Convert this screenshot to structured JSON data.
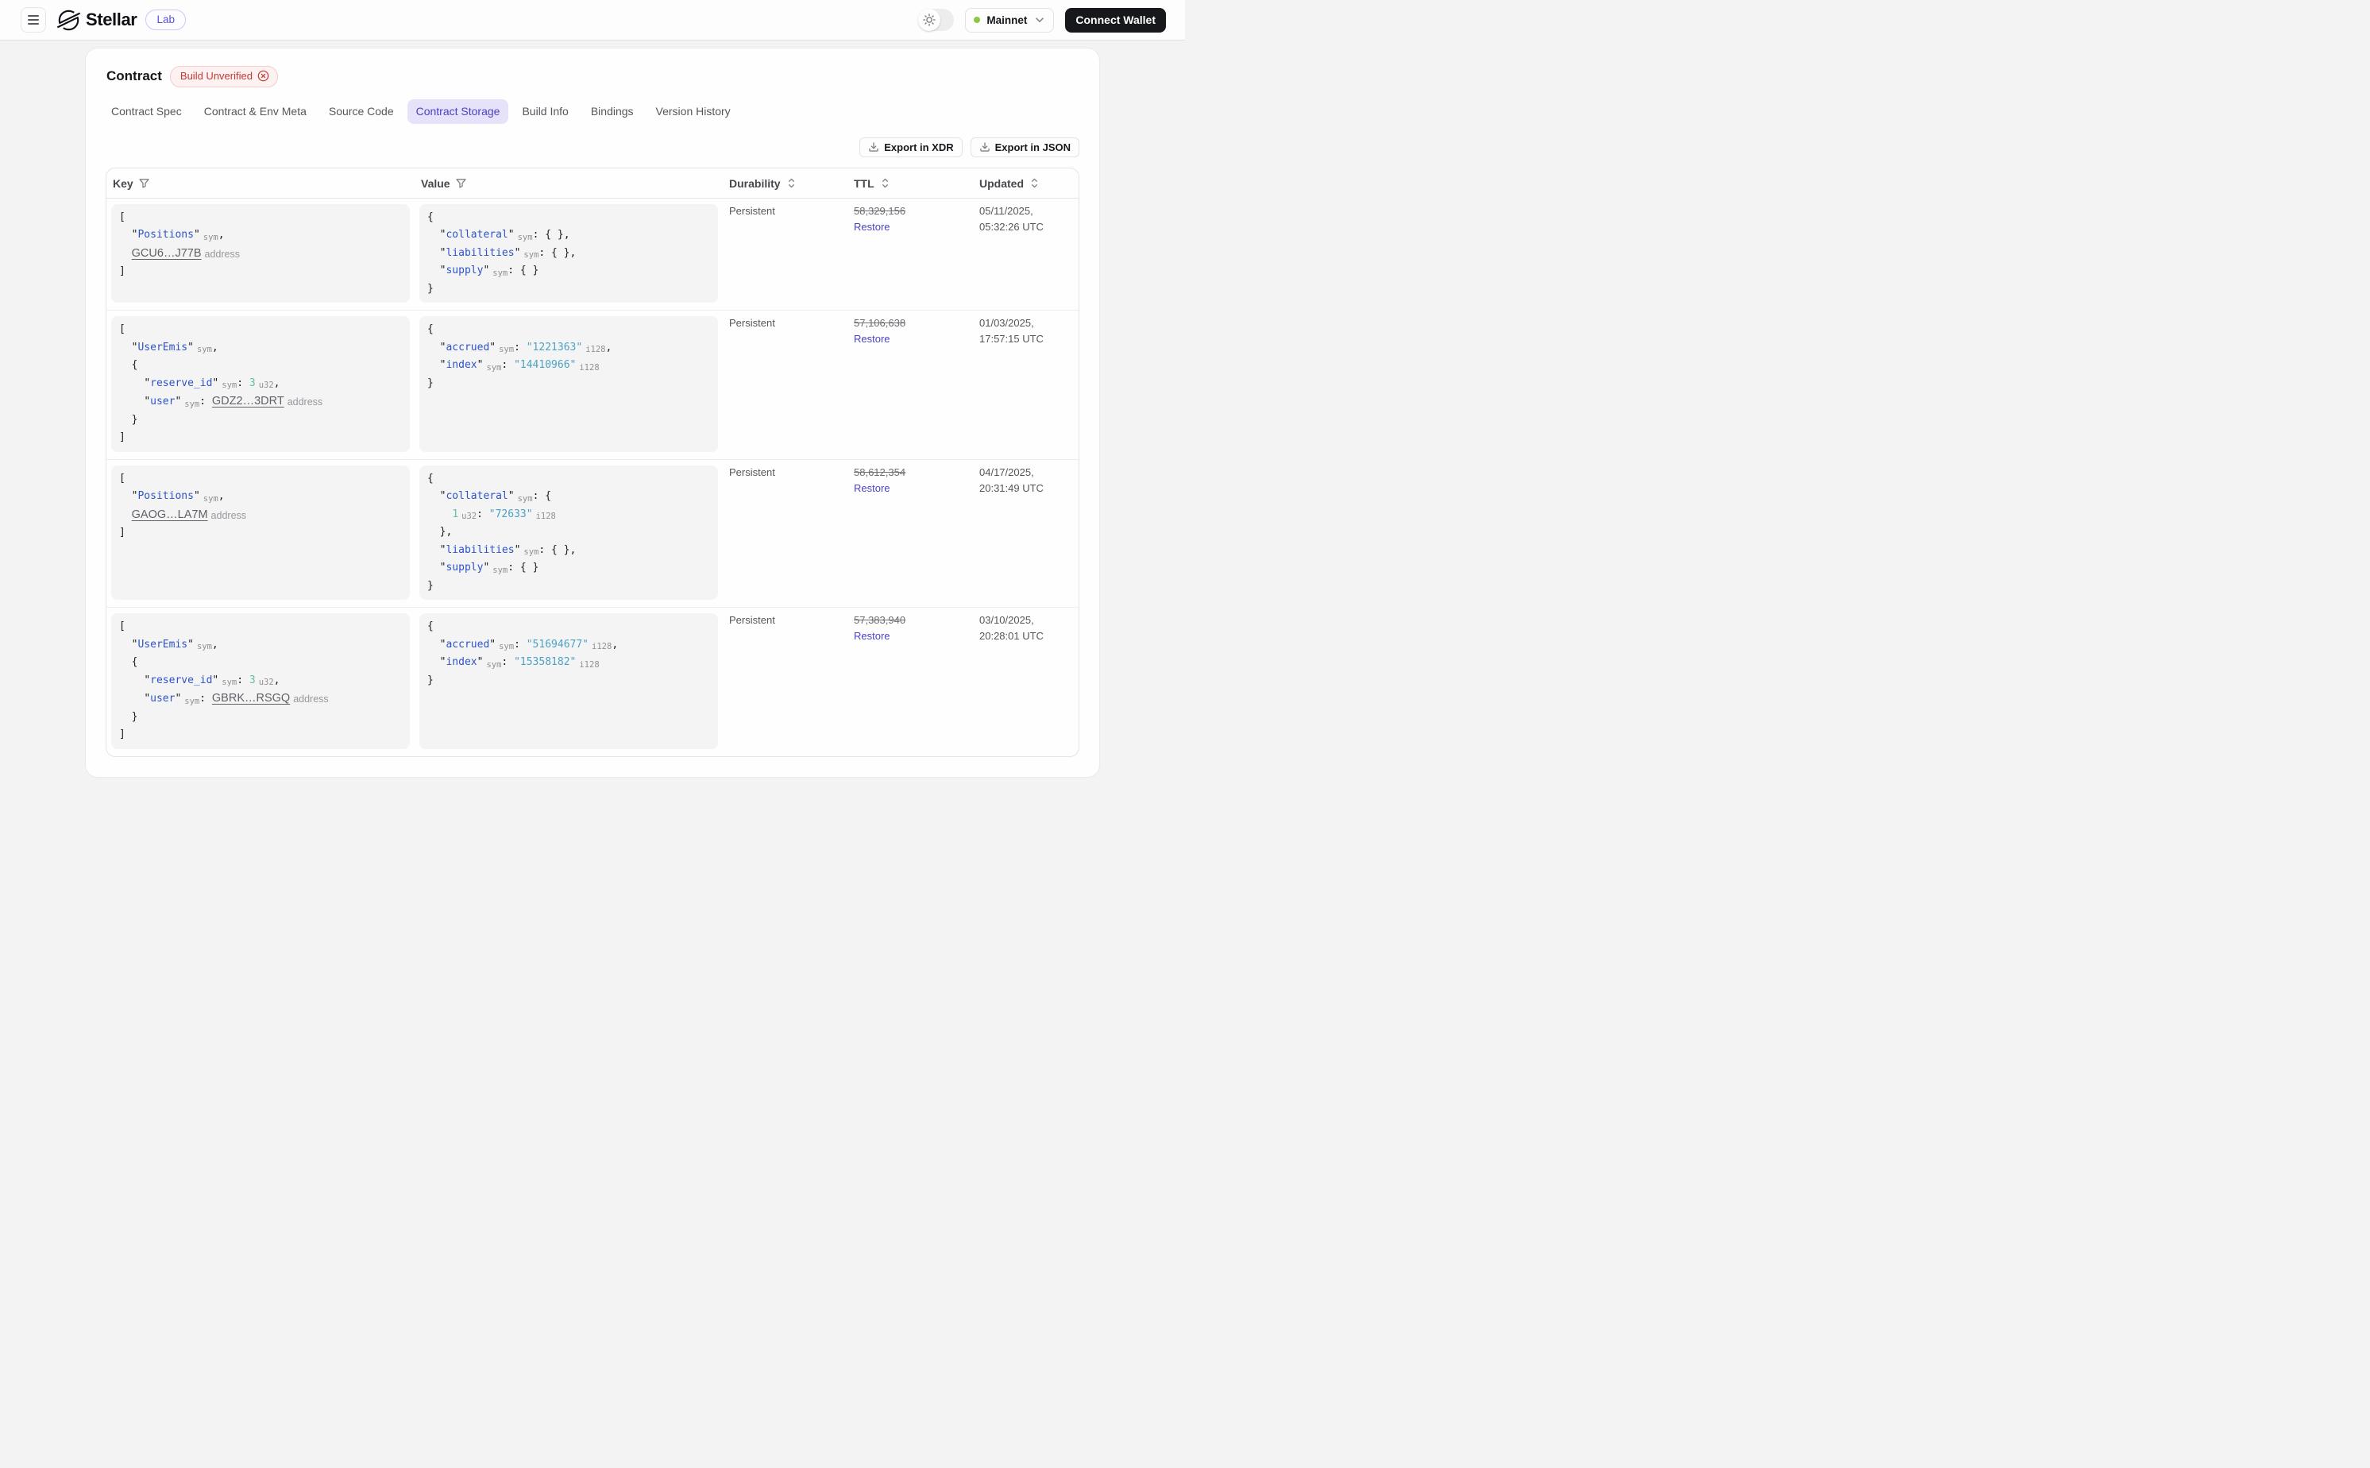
{
  "navbar": {
    "brand": "Stellar",
    "brand_badge": "Lab",
    "network_label": "Mainnet",
    "connect_wallet_label": "Connect Wallet"
  },
  "page": {
    "title": "Contract",
    "status_badge": "Build Unverified",
    "tabs": [
      {
        "label": "Contract Spec",
        "active": false
      },
      {
        "label": "Contract & Env Meta",
        "active": false
      },
      {
        "label": "Source Code",
        "active": false
      },
      {
        "label": "Contract Storage",
        "active": true
      },
      {
        "label": "Build Info",
        "active": false
      },
      {
        "label": "Bindings",
        "active": false
      },
      {
        "label": "Version History",
        "active": false
      }
    ],
    "export_xdr_label": "Export in XDR",
    "export_json_label": "Export in JSON"
  },
  "table": {
    "columns": [
      {
        "label": "Key",
        "icon": "filter"
      },
      {
        "label": "Value",
        "icon": "filter"
      },
      {
        "label": "Durability",
        "icon": "sort"
      },
      {
        "label": "TTL",
        "icon": "sort"
      },
      {
        "label": "Updated",
        "icon": "sort"
      }
    ],
    "rows": [
      {
        "key_code": [
          [
            {
              "t": "p",
              "v": "["
            }
          ],
          [
            {
              "t": "p",
              "v": "  "
            },
            {
              "t": "key",
              "v": "Positions"
            },
            {
              "t": "ann",
              "v": "sym"
            },
            {
              "t": "p",
              "v": ","
            }
          ],
          [
            {
              "t": "p",
              "v": "  "
            },
            {
              "t": "link",
              "v": "GCU6…J77B"
            },
            {
              "t": "ann",
              "v": "address"
            }
          ],
          [
            {
              "t": "p",
              "v": "]"
            }
          ]
        ],
        "value_code": [
          [
            {
              "t": "p",
              "v": "{"
            }
          ],
          [
            {
              "t": "p",
              "v": "  "
            },
            {
              "t": "key",
              "v": "collateral"
            },
            {
              "t": "ann",
              "v": "sym"
            },
            {
              "t": "p",
              "v": ": { },"
            }
          ],
          [
            {
              "t": "p",
              "v": "  "
            },
            {
              "t": "key",
              "v": "liabilities"
            },
            {
              "t": "ann",
              "v": "sym"
            },
            {
              "t": "p",
              "v": ": { },"
            }
          ],
          [
            {
              "t": "p",
              "v": "  "
            },
            {
              "t": "key",
              "v": "supply"
            },
            {
              "t": "ann",
              "v": "sym"
            },
            {
              "t": "p",
              "v": ": { }"
            }
          ],
          [
            {
              "t": "p",
              "v": "}"
            }
          ]
        ],
        "durability": "Persistent",
        "ttl": "58,329,156",
        "ttl_action": "Restore",
        "updated": [
          "05/11/2025,",
          "05:32:26 UTC"
        ]
      },
      {
        "key_code": [
          [
            {
              "t": "p",
              "v": "["
            }
          ],
          [
            {
              "t": "p",
              "v": "  "
            },
            {
              "t": "key",
              "v": "UserEmis"
            },
            {
              "t": "ann",
              "v": "sym"
            },
            {
              "t": "p",
              "v": ","
            }
          ],
          [
            {
              "t": "p",
              "v": "  {"
            }
          ],
          [
            {
              "t": "p",
              "v": "    "
            },
            {
              "t": "key",
              "v": "reserve_id"
            },
            {
              "t": "ann",
              "v": "sym"
            },
            {
              "t": "p",
              "v": ": "
            },
            {
              "t": "num",
              "v": "3"
            },
            {
              "t": "ann",
              "v": "u32"
            },
            {
              "t": "p",
              "v": ","
            }
          ],
          [
            {
              "t": "p",
              "v": "    "
            },
            {
              "t": "key",
              "v": "user"
            },
            {
              "t": "ann",
              "v": "sym"
            },
            {
              "t": "p",
              "v": ": "
            },
            {
              "t": "link",
              "v": "GDZ2…3DRT"
            },
            {
              "t": "ann",
              "v": "address"
            }
          ],
          [
            {
              "t": "p",
              "v": "  }"
            }
          ],
          [
            {
              "t": "p",
              "v": "]"
            }
          ]
        ],
        "value_code": [
          [
            {
              "t": "p",
              "v": "{"
            }
          ],
          [
            {
              "t": "p",
              "v": "  "
            },
            {
              "t": "key",
              "v": "accrued"
            },
            {
              "t": "ann",
              "v": "sym"
            },
            {
              "t": "p",
              "v": ": "
            },
            {
              "t": "str",
              "v": "1221363"
            },
            {
              "t": "ann",
              "v": "i128"
            },
            {
              "t": "p",
              "v": ","
            }
          ],
          [
            {
              "t": "p",
              "v": "  "
            },
            {
              "t": "key",
              "v": "index"
            },
            {
              "t": "ann",
              "v": "sym"
            },
            {
              "t": "p",
              "v": ": "
            },
            {
              "t": "str",
              "v": "14410966"
            },
            {
              "t": "ann",
              "v": "i128"
            }
          ],
          [
            {
              "t": "p",
              "v": "}"
            }
          ]
        ],
        "durability": "Persistent",
        "ttl": "57,106,638",
        "ttl_action": "Restore",
        "updated": [
          "01/03/2025,",
          "17:57:15 UTC"
        ]
      },
      {
        "key_code": [
          [
            {
              "t": "p",
              "v": "["
            }
          ],
          [
            {
              "t": "p",
              "v": "  "
            },
            {
              "t": "key",
              "v": "Positions"
            },
            {
              "t": "ann",
              "v": "sym"
            },
            {
              "t": "p",
              "v": ","
            }
          ],
          [
            {
              "t": "p",
              "v": "  "
            },
            {
              "t": "link",
              "v": "GAOG…LA7M"
            },
            {
              "t": "ann",
              "v": "address"
            }
          ],
          [
            {
              "t": "p",
              "v": "]"
            }
          ]
        ],
        "value_code": [
          [
            {
              "t": "p",
              "v": "{"
            }
          ],
          [
            {
              "t": "p",
              "v": "  "
            },
            {
              "t": "key",
              "v": "collateral"
            },
            {
              "t": "ann",
              "v": "sym"
            },
            {
              "t": "p",
              "v": ": {"
            }
          ],
          [
            {
              "t": "p",
              "v": "    "
            },
            {
              "t": "num",
              "v": "1"
            },
            {
              "t": "ann",
              "v": "u32"
            },
            {
              "t": "p",
              "v": ": "
            },
            {
              "t": "str",
              "v": "72633"
            },
            {
              "t": "ann",
              "v": "i128"
            }
          ],
          [
            {
              "t": "p",
              "v": "  },"
            }
          ],
          [
            {
              "t": "p",
              "v": "  "
            },
            {
              "t": "key",
              "v": "liabilities"
            },
            {
              "t": "ann",
              "v": "sym"
            },
            {
              "t": "p",
              "v": ": { },"
            }
          ],
          [
            {
              "t": "p",
              "v": "  "
            },
            {
              "t": "key",
              "v": "supply"
            },
            {
              "t": "ann",
              "v": "sym"
            },
            {
              "t": "p",
              "v": ": { }"
            }
          ],
          [
            {
              "t": "p",
              "v": "}"
            }
          ]
        ],
        "durability": "Persistent",
        "ttl": "58,612,354",
        "ttl_action": "Restore",
        "updated": [
          "04/17/2025,",
          "20:31:49 UTC"
        ]
      },
      {
        "key_code": [
          [
            {
              "t": "p",
              "v": "["
            }
          ],
          [
            {
              "t": "p",
              "v": "  "
            },
            {
              "t": "key",
              "v": "UserEmis"
            },
            {
              "t": "ann",
              "v": "sym"
            },
            {
              "t": "p",
              "v": ","
            }
          ],
          [
            {
              "t": "p",
              "v": "  {"
            }
          ],
          [
            {
              "t": "p",
              "v": "    "
            },
            {
              "t": "key",
              "v": "reserve_id"
            },
            {
              "t": "ann",
              "v": "sym"
            },
            {
              "t": "p",
              "v": ": "
            },
            {
              "t": "num",
              "v": "3"
            },
            {
              "t": "ann",
              "v": "u32"
            },
            {
              "t": "p",
              "v": ","
            }
          ],
          [
            {
              "t": "p",
              "v": "    "
            },
            {
              "t": "key",
              "v": "user"
            },
            {
              "t": "ann",
              "v": "sym"
            },
            {
              "t": "p",
              "v": ": "
            },
            {
              "t": "link",
              "v": "GBRK…RSGQ"
            },
            {
              "t": "ann",
              "v": "address"
            }
          ],
          [
            {
              "t": "p",
              "v": "  }"
            }
          ],
          [
            {
              "t": "p",
              "v": "]"
            }
          ]
        ],
        "value_code": [
          [
            {
              "t": "p",
              "v": "{"
            }
          ],
          [
            {
              "t": "p",
              "v": "  "
            },
            {
              "t": "key",
              "v": "accrued"
            },
            {
              "t": "ann",
              "v": "sym"
            },
            {
              "t": "p",
              "v": ": "
            },
            {
              "t": "str",
              "v": "51694677"
            },
            {
              "t": "ann",
              "v": "i128"
            },
            {
              "t": "p",
              "v": ","
            }
          ],
          [
            {
              "t": "p",
              "v": "  "
            },
            {
              "t": "key",
              "v": "index"
            },
            {
              "t": "ann",
              "v": "sym"
            },
            {
              "t": "p",
              "v": ": "
            },
            {
              "t": "str",
              "v": "15358182"
            },
            {
              "t": "ann",
              "v": "i128"
            }
          ],
          [
            {
              "t": "p",
              "v": "}"
            }
          ]
        ],
        "durability": "Persistent",
        "ttl": "57,383,940",
        "ttl_action": "Restore",
        "updated": [
          "03/10/2025,",
          "20:28:01 UTC"
        ]
      }
    ]
  },
  "colors": {
    "accent_purple": "#4c42c4",
    "tab_active_bg": "#e6e2f9",
    "badge_red_text": "#c13a31",
    "badge_red_bg": "#fdf2f1",
    "code_key_blue": "#2d53c7",
    "code_string_teal": "#4ba2c4",
    "code_number_green": "#61c2a0",
    "network_dot_green": "#8fc640",
    "wallet_button_black": "#17181c"
  }
}
